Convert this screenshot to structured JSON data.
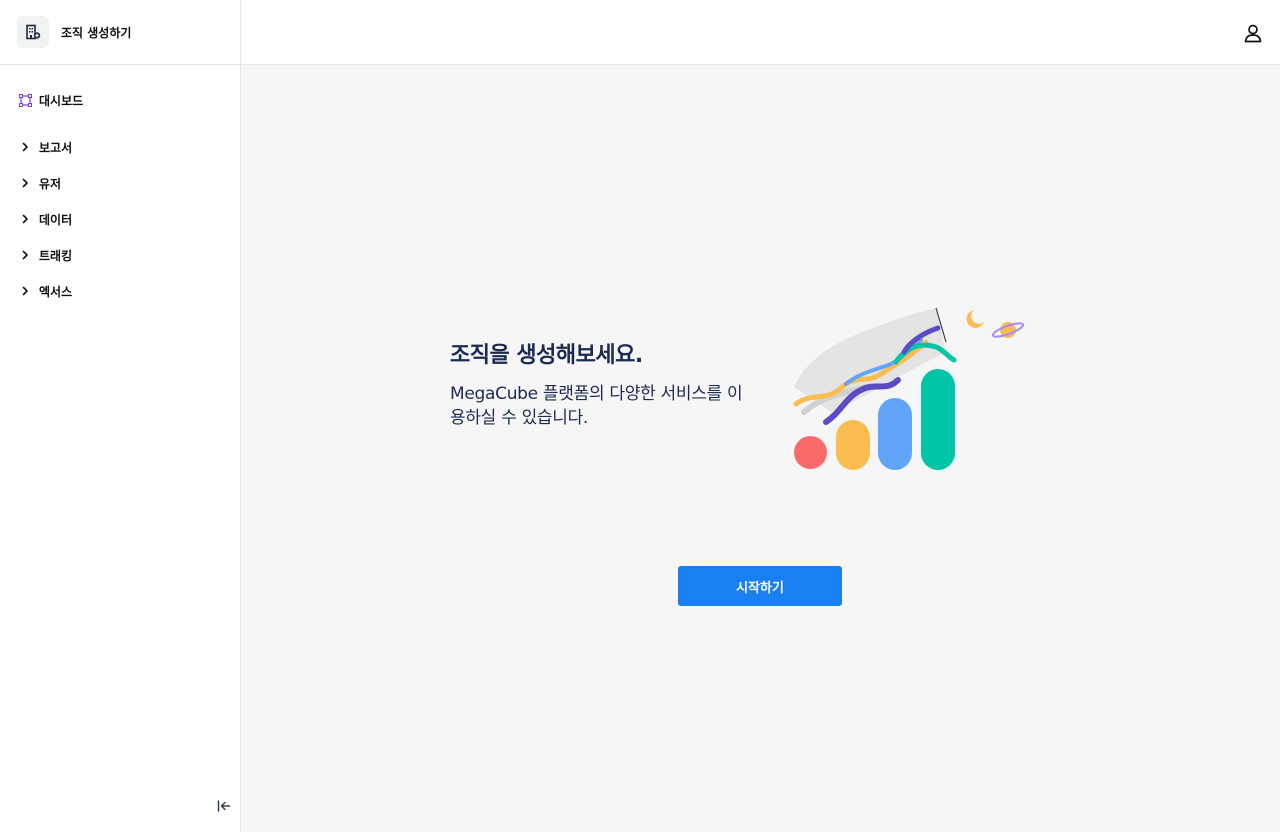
{
  "org": {
    "title": "조직 생성하기",
    "icon": "building-icon"
  },
  "sidebar": {
    "items": [
      {
        "label": "대시보드",
        "icon": "dashboard-icon"
      },
      {
        "label": "보고서",
        "icon": "chevron-right-icon"
      },
      {
        "label": "유저",
        "icon": "chevron-right-icon"
      },
      {
        "label": "데이터",
        "icon": "chevron-right-icon"
      },
      {
        "label": "트래킹",
        "icon": "chevron-right-icon"
      },
      {
        "label": "엑서스",
        "icon": "chevron-right-icon"
      }
    ],
    "collapse_icon": "collapse-sidebar-icon"
  },
  "header": {
    "user_icon": "user-icon"
  },
  "main": {
    "headline": "조직을 생성해보세요.",
    "description": "MegaCube 플랫폼의 다양한 서비스를 이용하실 수 있습니다.",
    "start_button": "시작하기"
  },
  "colors": {
    "accent": "#1a7ff2",
    "headline": "#1b2a55",
    "bar_red": "#f96a6a",
    "bar_yellow": "#fbbd4f",
    "bar_blue": "#60a5fa",
    "bar_green": "#00c5a6",
    "dashboard_icon": "#7c3aed"
  }
}
